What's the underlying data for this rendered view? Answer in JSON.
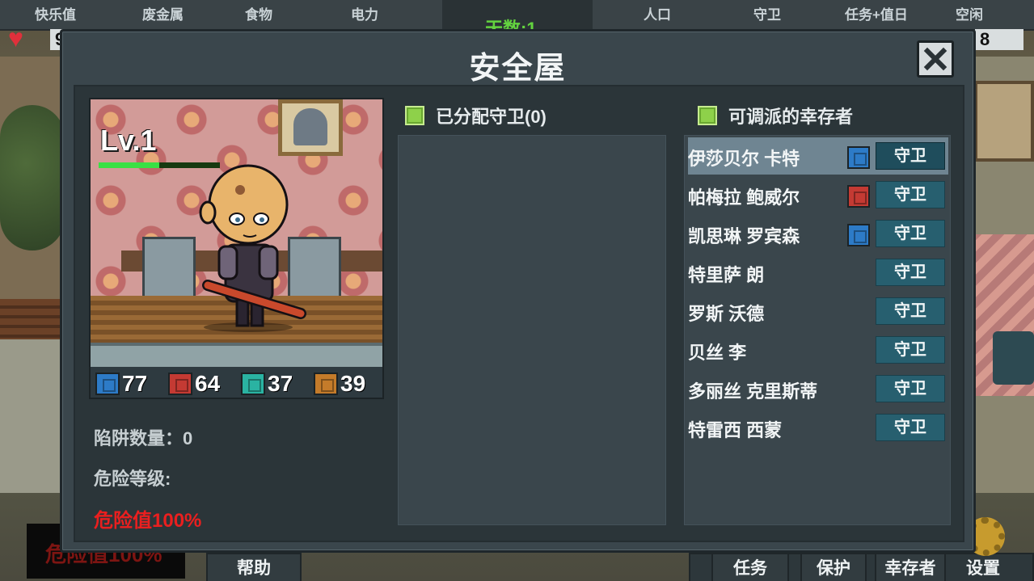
{
  "hud": {
    "top_labels": [
      "快乐值",
      "废金属",
      "食物",
      "电力",
      "人口",
      "守卫",
      "任务+值日",
      "空闲"
    ],
    "day_label": "天数:1",
    "happiness_value": "9",
    "idle_value": "8",
    "danger_overlay_text": "危险值100%",
    "bottom_buttons": [
      "帮助",
      "任务",
      "保护",
      "幸存者",
      "设置"
    ]
  },
  "modal": {
    "title": "安全屋",
    "level_label": "Lv.1",
    "level_progress": 0.5,
    "stats": [
      {
        "icon": "blue",
        "value": "77"
      },
      {
        "icon": "red",
        "value": "64"
      },
      {
        "icon": "teal",
        "value": "37"
      },
      {
        "icon": "orange",
        "value": "39"
      }
    ],
    "trap_count_label": "陷阱数量：0",
    "danger_level_label": "危险等级:",
    "danger_value": "危险值100%",
    "assigned_header": "已分配守卫(0)",
    "available_header": "可调派的幸存者",
    "guard_label": "守卫",
    "survivors": [
      {
        "name": "伊莎贝尔 卡特",
        "badge": "blue",
        "selected": true
      },
      {
        "name": "帕梅拉 鲍威尔",
        "badge": "red",
        "selected": false
      },
      {
        "name": "凯思琳 罗宾森",
        "badge": "blue",
        "selected": false
      },
      {
        "name": "特里萨 朗",
        "badge": "",
        "selected": false
      },
      {
        "name": "罗斯 沃德",
        "badge": "",
        "selected": false
      },
      {
        "name": "贝丝 李",
        "badge": "",
        "selected": false
      },
      {
        "name": "多丽丝 克里斯蒂",
        "badge": "",
        "selected": false
      },
      {
        "name": "特雷西 西蒙",
        "badge": "",
        "selected": false
      }
    ]
  },
  "colors": {
    "accent_green": "#39e044",
    "danger_red": "#ea1f1f",
    "guard_button": "#275f6f"
  }
}
